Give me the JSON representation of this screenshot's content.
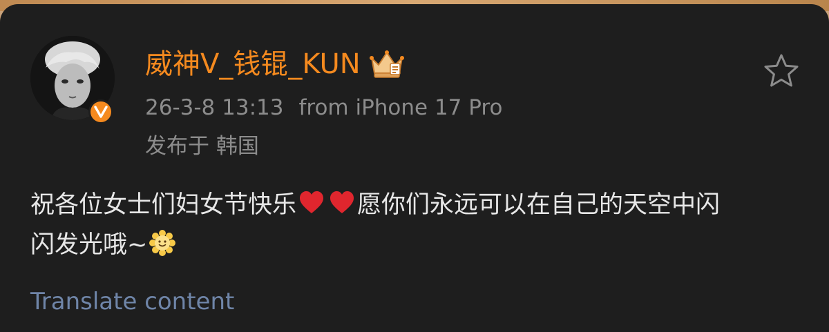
{
  "post": {
    "author": {
      "name": "威神V_钱锟_KUN",
      "avatar_icon": "avatar-photo",
      "verified_badge": "V",
      "member_badge_icon": "crown-badge-icon"
    },
    "timestamp": "26-3-8 13:13",
    "source": "from iPhone 17 Pro",
    "location": "发布于 韩国",
    "content": {
      "line1_part1": "祝各位女士们妇女节快乐",
      "line1_emoji1": "red-heart-emoji",
      "line1_emoji2": "red-heart-emoji",
      "line1_part2": "愿你们永远可以在自己的天空中闪",
      "line2_part1": "闪发光哦~",
      "line2_emoji": "sun-flower-emoji"
    },
    "translate_link": "Translate content",
    "favorite_icon": "star-outline-icon"
  },
  "colors": {
    "background": "#1e1e1e",
    "username": "#f58a1f",
    "meta_text": "#8c8c8c",
    "body_text": "#e7e7e7",
    "link": "#6f85a8",
    "verified_badge": "#f58a1f"
  }
}
